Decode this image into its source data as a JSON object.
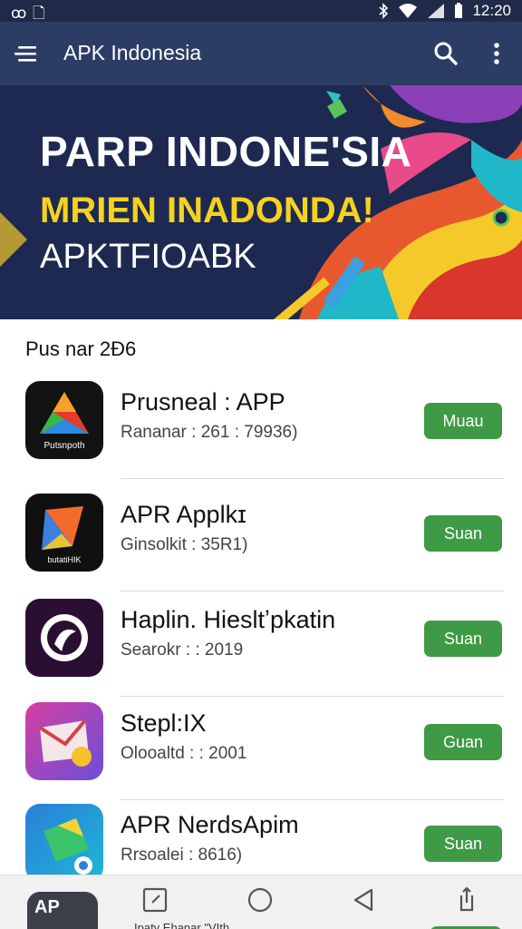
{
  "status_bar": {
    "left_text": "ꝏ 🗋",
    "time": "12:20",
    "icons": [
      "bluetooth-icon",
      "wifi-icon",
      "signal-icon",
      "battery-icon"
    ]
  },
  "app_bar": {
    "title": "APK Indonesia",
    "icons": [
      "menu-icon",
      "search-icon",
      "more-vert-icon"
    ],
    "background": "#2b3d64"
  },
  "banner": {
    "line1": "PARP INDONE'SIA",
    "line2": "MRIEN INADONDA!",
    "line3": "APKTFIOABK",
    "colors": {
      "line1": "#ffffff",
      "line2": "#f4d21f",
      "line3": "#ffffff",
      "background": "#1d2950"
    }
  },
  "section_title": "Pus nar 2Ð6",
  "apps": [
    {
      "name": "Prusneal : APP",
      "meta": "Rananar : 261 : 79936)",
      "button": "Muau",
      "icon_label": "Putsnpoth",
      "icon": "triangle-logo-icon"
    },
    {
      "name": "APR Applkɪ",
      "meta": "Ginsolkit : 35R1)",
      "button": "Suan",
      "icon_label": "butatiHIK",
      "icon": "folded-arrow-icon"
    },
    {
      "name": "Haplin. Hiesltʼpkatin",
      "meta": "Searokr : : 2019",
      "button": "Suan",
      "icon_label": "",
      "icon": "swirl-logo-icon"
    },
    {
      "name": "Stepl:IX",
      "meta": "Olooaltd : : 2001",
      "button": "Guan",
      "icon_label": "",
      "icon": "envelope-badge-icon"
    },
    {
      "name": "APR NerdsApim",
      "meta": "Rrsoalei : 8616)",
      "button": "Suan",
      "icon_label": "",
      "icon": "diamond-tile-icon"
    }
  ],
  "button_color": "#3f9a46",
  "bottom_nav": {
    "app_tile_label": "AP",
    "labels": [
      "Ipaty Ehanar \"VIth"
    ],
    "icons": [
      "square-edit-icon",
      "circle-home-icon",
      "triangle-back-icon",
      "share-icon"
    ]
  }
}
